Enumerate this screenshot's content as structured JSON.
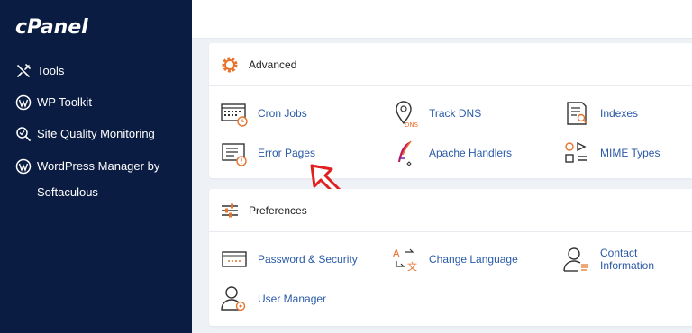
{
  "sidebar": {
    "logo": "cPanel",
    "items": [
      {
        "label": "Tools",
        "icon": "tools-icon"
      },
      {
        "label": "WP Toolkit",
        "icon": "wordpress-icon"
      },
      {
        "label": "Site Quality Monitoring",
        "icon": "search-quality-icon"
      },
      {
        "label": "WordPress Manager by Softaculous",
        "icon": "wordpress-icon"
      }
    ]
  },
  "advanced": {
    "title": "Advanced",
    "items": [
      {
        "label": "Cron Jobs",
        "icon": "cron-jobs-icon"
      },
      {
        "label": "Track DNS",
        "icon": "track-dns-icon"
      },
      {
        "label": "Indexes",
        "icon": "indexes-icon"
      },
      {
        "label": "Error Pages",
        "icon": "error-pages-icon"
      },
      {
        "label": "Apache Handlers",
        "icon": "apache-handlers-icon"
      },
      {
        "label": "MIME Types",
        "icon": "mime-types-icon"
      }
    ]
  },
  "preferences": {
    "title": "Preferences",
    "items": [
      {
        "label": "Password & Security",
        "icon": "password-security-icon"
      },
      {
        "label": "Change Language",
        "icon": "change-language-icon"
      },
      {
        "label": "Contact Information",
        "icon": "contact-information-icon"
      },
      {
        "label": "User Manager",
        "icon": "user-manager-icon"
      }
    ]
  },
  "colors": {
    "sidebar_bg": "#0b1c43",
    "link": "#2a5aa6",
    "accent_orange": "#e8732c",
    "arrow_red": "#e01f1f"
  }
}
